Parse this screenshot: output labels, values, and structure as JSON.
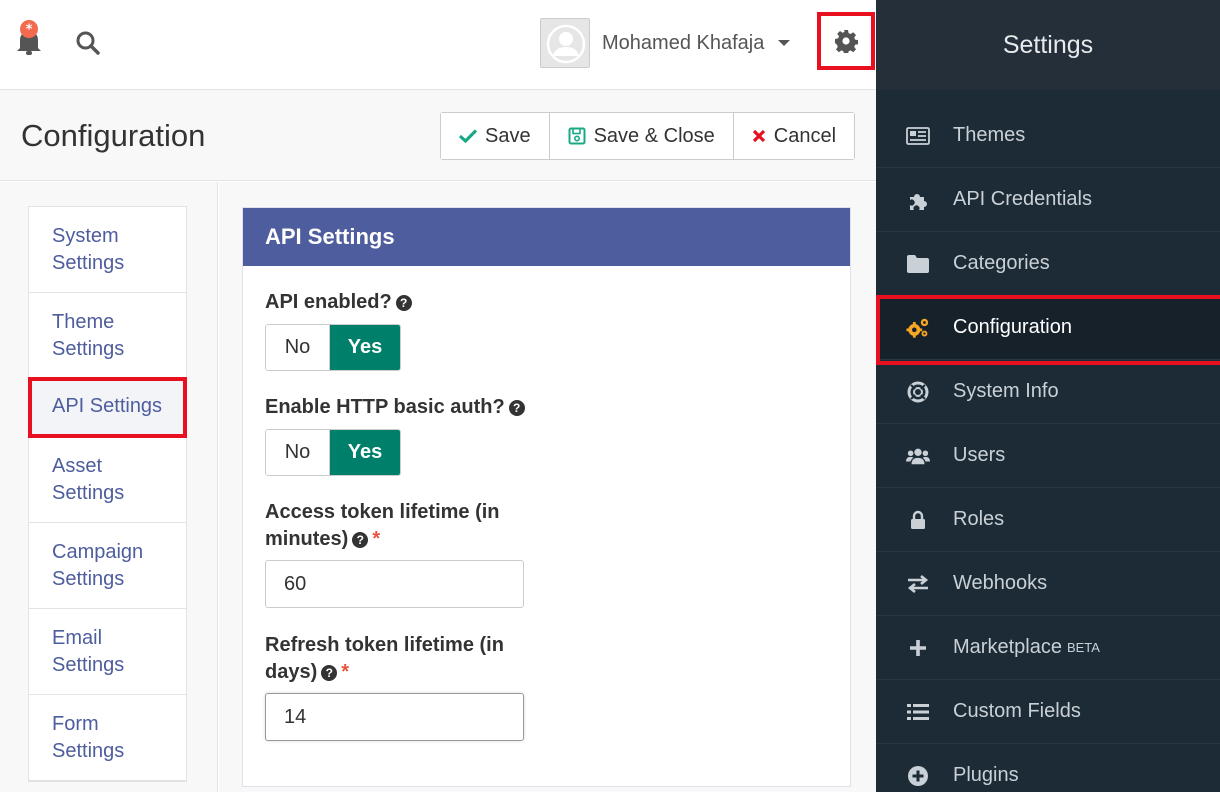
{
  "header": {
    "user_name": "Mohamed Khafaja"
  },
  "page": {
    "title": "Configuration",
    "buttons": {
      "save": "Save",
      "save_close": "Save & Close",
      "cancel": "Cancel"
    }
  },
  "left_nav": {
    "items": [
      {
        "line1": "System",
        "line2": "Settings"
      },
      {
        "line1": "Theme",
        "line2": "Settings"
      },
      {
        "label": "API Settings"
      },
      {
        "line1": "Asset",
        "line2": "Settings"
      },
      {
        "line1": "Campaign",
        "line2": "Settings"
      },
      {
        "line1": "Email",
        "line2": "Settings"
      },
      {
        "line1": "Form",
        "line2": "Settings"
      }
    ]
  },
  "panel": {
    "title": "API Settings",
    "api_enabled": {
      "label": "API enabled?",
      "no": "No",
      "yes": "Yes"
    },
    "basic_auth": {
      "label": "Enable HTTP basic auth?",
      "no": "No",
      "yes": "Yes"
    },
    "access_token": {
      "label_line1": "Access token lifetime (in",
      "label_line2": "minutes)",
      "required": "*",
      "value": "60"
    },
    "refresh_token": {
      "label_line1": "Refresh token lifetime (in",
      "label_line2": "days)",
      "required": "*",
      "value": "14"
    }
  },
  "sidebar": {
    "title": "Settings",
    "items": [
      {
        "label": "Themes",
        "icon": "newspaper-icon"
      },
      {
        "label": "API Credentials",
        "icon": "puzzle-icon"
      },
      {
        "label": "Categories",
        "icon": "folder-icon"
      },
      {
        "label": "Configuration",
        "icon": "cogs-icon"
      },
      {
        "label": "System Info",
        "icon": "life-ring-icon"
      },
      {
        "label": "Users",
        "icon": "users-icon"
      },
      {
        "label": "Roles",
        "icon": "lock-icon"
      },
      {
        "label": "Webhooks",
        "icon": "exchange-icon"
      },
      {
        "label": "Marketplace",
        "badge": "BETA",
        "icon": "plus-icon"
      },
      {
        "label": "Custom Fields",
        "icon": "list-icon"
      },
      {
        "label": "Plugins",
        "icon": "plus-circle-icon"
      }
    ]
  },
  "colors": {
    "accent": "#4e5d9d",
    "toggle_yes": "#00806a",
    "highlight": "#e8101e",
    "sidebar_bg": "#1d2b36",
    "active_icon": "#f5a623"
  }
}
